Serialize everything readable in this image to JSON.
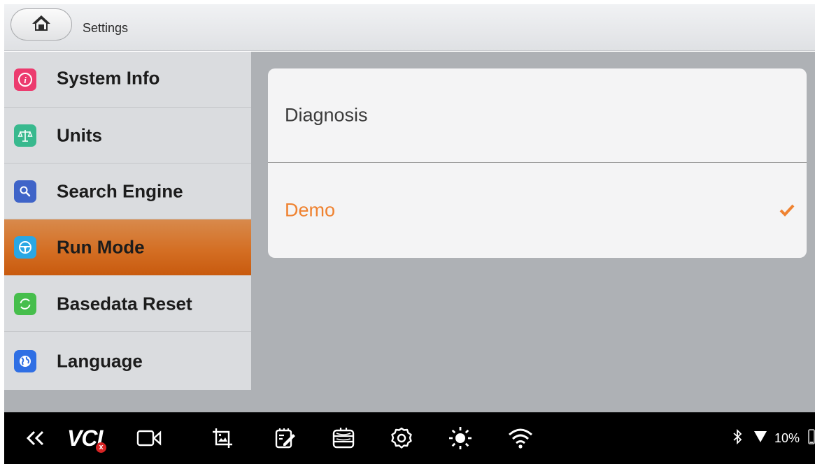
{
  "header": {
    "title": "Settings",
    "home_icon": "home-icon"
  },
  "sidebar": {
    "active_index": 3,
    "items": [
      {
        "label": "System Info",
        "icon": "info-icon",
        "color": "#ec3b6e"
      },
      {
        "label": "Units",
        "icon": "scale-icon",
        "color": "#38b98e"
      },
      {
        "label": "Search Engine",
        "icon": "search-icon",
        "color": "#3f64c8"
      },
      {
        "label": "Run Mode",
        "icon": "steering-wheel-icon",
        "color": "#2aa7e4"
      },
      {
        "label": "Basedata Reset",
        "icon": "reset-icon",
        "color": "#46be4c"
      },
      {
        "label": "Language",
        "icon": "globe-icon",
        "color": "#2f6fe4"
      }
    ]
  },
  "run_mode": {
    "options": [
      {
        "label": "Diagnosis",
        "selected": false
      },
      {
        "label": "Demo",
        "selected": true
      }
    ],
    "accent_color": "#ef8230"
  },
  "taskbar": {
    "vci_label": "VCI",
    "vci_status_badge": "x",
    "icons": [
      "back-double-chevron-icon",
      "vci-icon",
      "screen-record-icon",
      "screenshot-icon",
      "notes-icon",
      "toolbox-icon",
      "settings-gear-icon",
      "brightness-icon",
      "wifi-icon"
    ],
    "status": {
      "bluetooth_icon": "bluetooth-icon",
      "signal_icon": "signal-icon",
      "battery_percent": "10%"
    }
  }
}
